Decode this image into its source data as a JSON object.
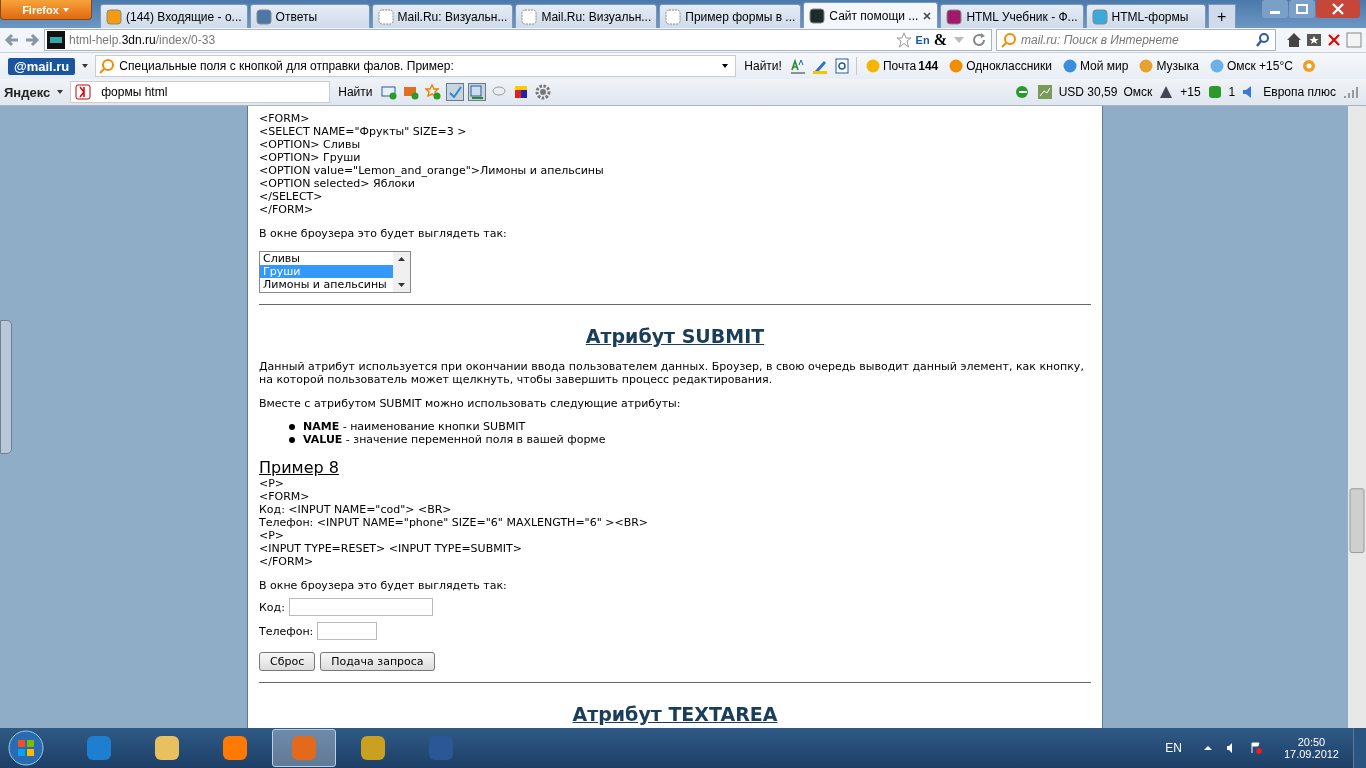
{
  "browser": {
    "menu_button": "Firefox",
    "tabs": [
      {
        "label": "(144) Входящие - о...",
        "selected": false
      },
      {
        "label": "Ответы",
        "selected": false
      },
      {
        "label": "Mail.Ru: Визуальн...",
        "selected": false
      },
      {
        "label": "Mail.Ru: Визуальн...",
        "selected": false
      },
      {
        "label": "Пример формы в ...",
        "selected": false
      },
      {
        "label": "Сайт помощи ...",
        "selected": true
      },
      {
        "label": "HTML Учебник - Ф...",
        "selected": false
      },
      {
        "label": "HTML-формы",
        "selected": false
      }
    ],
    "new_tab": "+",
    "address": {
      "prefix": "html-help.",
      "domain": "3dn.ru",
      "path": "/index/0-33"
    },
    "lang_badge": "En",
    "amp": "&",
    "search": {
      "placeholder": "mail.ru: Поиск в Интернете"
    }
  },
  "mailru_bar": {
    "logo": "@mail.ru",
    "query": "Специальные поля с кнопкой для отправки фалов. Пример:",
    "find": "Найти!",
    "links": [
      {
        "label": "Почта",
        "count": "144"
      },
      {
        "label": "Одноклассники"
      },
      {
        "label": "Мой мир"
      },
      {
        "label": "Музыка"
      },
      {
        "label": "Омск +15°C"
      }
    ]
  },
  "yandex_bar": {
    "logo": "Яндекс",
    "query": "формы html",
    "find": "Найти",
    "currency": "USD 30,59",
    "city": "Омск",
    "temp": "+15",
    "count": "1",
    "radio": "Европа плюс"
  },
  "page": {
    "code_1": [
      "<FORM>",
      "<SELECT NAME=\"Фрукты\" SIZE=3 >",
      "<OPTION> Сливы",
      "<OPTION> Груши",
      "<OPTION value=\"Lemon_and_orange\">Лимоны и апельсины",
      "<OPTION selected> Яблоки",
      "</SELECT>",
      "</FORM>"
    ],
    "note_1": "В окне броузера это будет выглядеть так:",
    "listbox": [
      {
        "label": "Сливы",
        "selected": false
      },
      {
        "label": "Груши",
        "selected": true
      },
      {
        "label": "Лимоны и апельсины",
        "selected": false
      }
    ],
    "heading": "Атрибут SUBMIT",
    "paragraphs": [
      "Данный атрибут используется при окончании ввода пользователем данных. Броузер, в свою очередь выводит данный элемент, как кнопку, на которой пользователь может щелкнуть, чтобы завершить процесс редактирования.",
      "Вместе с атрибутом SUBMIT можно использовать следующие атрибуты:"
    ],
    "bullets": [
      "**NAME** - наименование кнопки SUBMIT",
      "**VALUE** - значение переменной поля в вашей форме"
    ],
    "example_title": "Пример 8",
    "code_2": [
      "<P>",
      "<FORM>",
      "Код: <INPUT NAME=\"cod\"> <BR>",
      "Телефон: <INPUT NAME=\"phone\" SIZE=\"6\" MAXLENGTH=\"6\" ><BR>",
      "<P>",
      "<INPUT TYPE=RESET> <INPUT TYPE=SUBMIT>",
      "</FORM>"
    ],
    "note_2": "В окне броузера это будет выглядеть так:",
    "fields": [
      {
        "label": "Код:",
        "kind": "long"
      },
      {
        "label": "Телефон:",
        "kind": "short"
      }
    ],
    "buttons": [
      "Сброс",
      "Подача запроса"
    ],
    "next_heading": "Атрибут TEXTAREA"
  },
  "taskbar": {
    "apps": [
      {
        "selected": false
      },
      {
        "selected": false
      },
      {
        "selected": false
      },
      {
        "selected": true
      },
      {
        "selected": false
      },
      {
        "selected": false
      }
    ],
    "lang": "EN",
    "time": "20:50",
    "date": "17.09.2012"
  }
}
